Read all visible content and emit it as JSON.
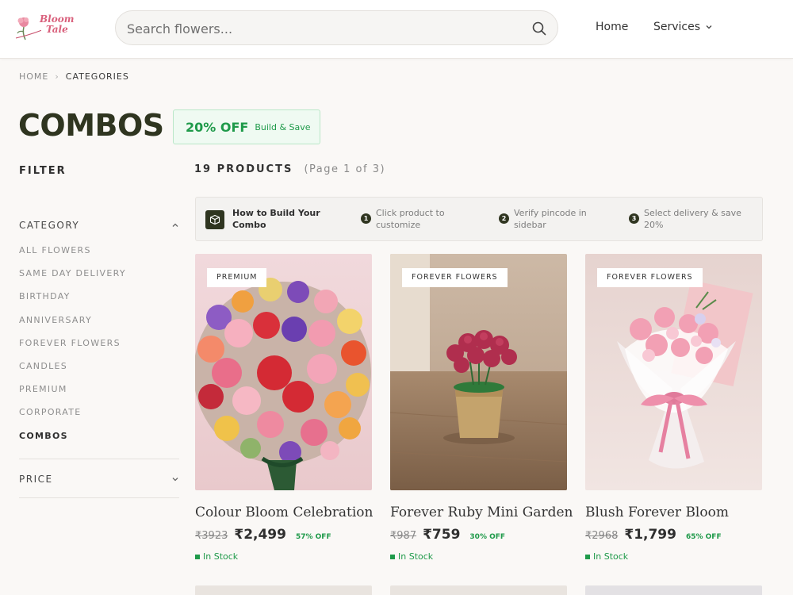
{
  "header": {
    "logo_line1": "Bloom",
    "logo_line2": "Tale",
    "search_placeholder": "Search flowers...",
    "nav_home": "Home",
    "nav_services": "Services"
  },
  "breadcrumb": {
    "home": "HOME",
    "separator": "›",
    "current": "CATEGORIES"
  },
  "page": {
    "title": "COMBOS",
    "promo_off": "20% OFF",
    "promo_sub": "Build & Save"
  },
  "filter": {
    "title": "FILTER",
    "category_label": "CATEGORY",
    "categories": [
      {
        "label": "ALL FLOWERS"
      },
      {
        "label": "SAME DAY DELIVERY"
      },
      {
        "label": "BIRTHDAY"
      },
      {
        "label": "ANNIVERSARY"
      },
      {
        "label": "FOREVER FLOWERS"
      },
      {
        "label": "CANDLES"
      },
      {
        "label": "PREMIUM"
      },
      {
        "label": "CORPORATE"
      },
      {
        "label": "COMBOS"
      }
    ],
    "price_label": "PRICE"
  },
  "products_meta": {
    "count": "19 PRODUCTS",
    "page": "(Page 1 of 3)"
  },
  "howto": {
    "title": "How to Build Your Combo",
    "steps": [
      {
        "num": "1",
        "text": "Click product to customize"
      },
      {
        "num": "2",
        "text": "Verify pincode in sidebar"
      },
      {
        "num": "3",
        "text": "Select delivery & save 20%"
      }
    ]
  },
  "products": [
    {
      "tag": "PREMIUM",
      "name": "Colour Bloom Celebration",
      "old_price": "₹3923",
      "price": "₹2,499",
      "off": "57% OFF",
      "stock": "In Stock"
    },
    {
      "tag": "FOREVER FLOWERS",
      "name": "Forever Ruby Mini Garden",
      "old_price": "₹987",
      "price": "₹759",
      "off": "30% OFF",
      "stock": "In Stock"
    },
    {
      "tag": "FOREVER FLOWERS",
      "name": "Blush Forever Bloom",
      "old_price": "₹2968",
      "price": "₹1,799",
      "off": "65% OFF",
      "stock": "In Stock"
    }
  ],
  "colors": {
    "accent_green": "#1f9a4a",
    "title_dark": "#2f3520",
    "brand_pink": "#d9607c"
  }
}
